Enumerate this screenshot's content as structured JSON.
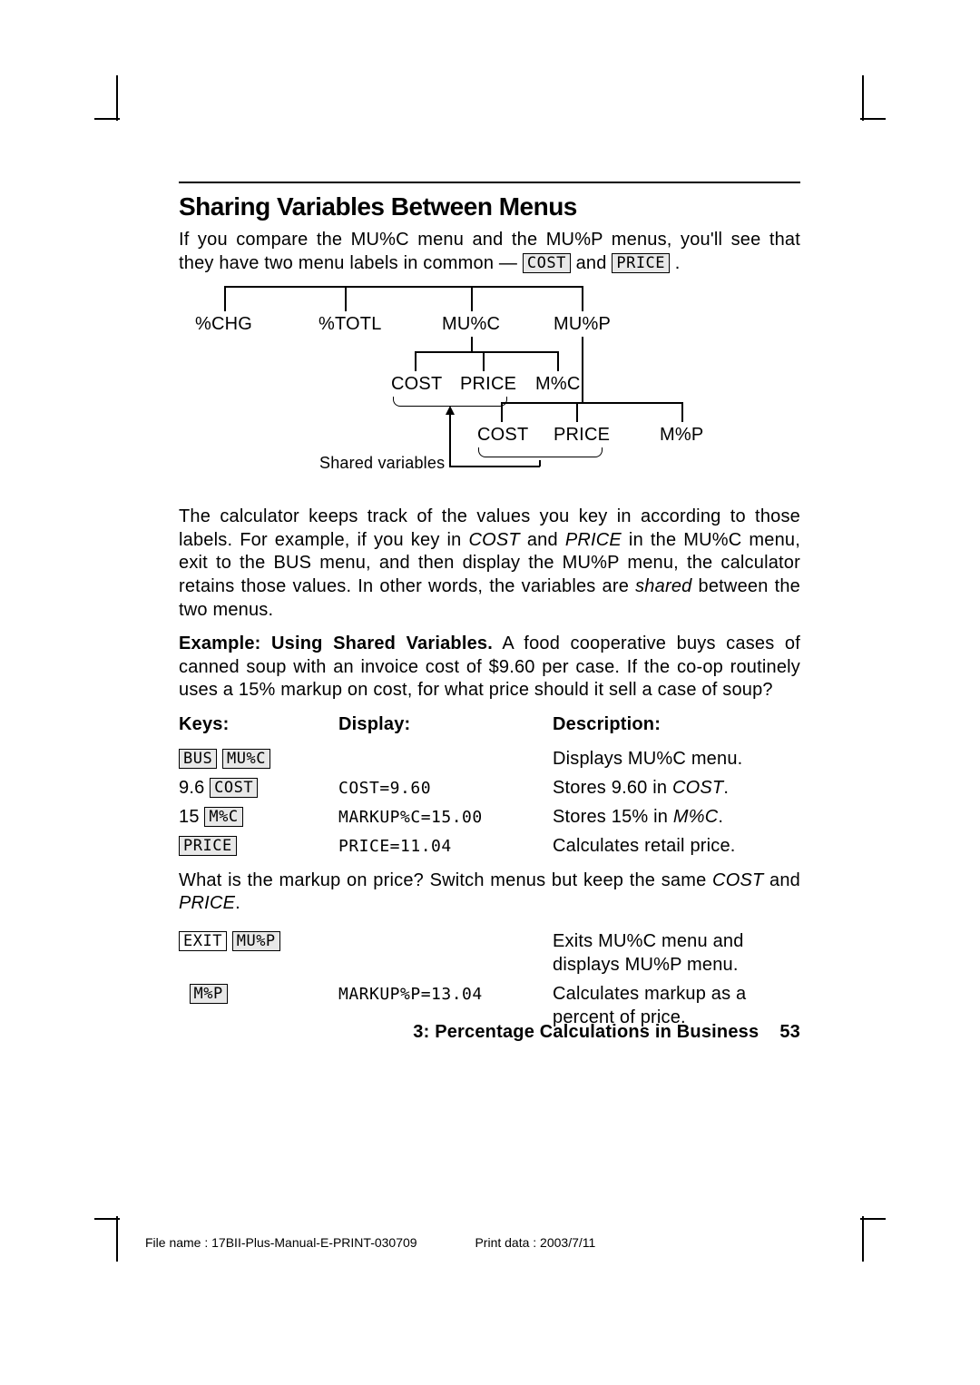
{
  "heading": "Sharing Variables Between Menus",
  "intro_1a": "If you compare the MU%C menu and the MU%P menus, you'll see that they have two menu labels in common — ",
  "key_cost": " COST ",
  "intro_1b": " and ",
  "key_price": "PRICE",
  "intro_1c": ".",
  "diagram": {
    "top": [
      "%CHG",
      "%TOTL",
      "MU%C",
      "MU%P"
    ],
    "mid": [
      "COST",
      "PRICE",
      "M%C"
    ],
    "bot": [
      "COST",
      "PRICE",
      "M%P"
    ],
    "shared_label": "Shared variables"
  },
  "para2_a": "The calculator keeps track of the values you key in according to those labels. For example, if you key in ",
  "para2_b": " and ",
  "para2_c": " in the MU%C menu, exit to the BUS menu, and then display the MU%P menu, the calculator retains those values. In other words, the variables are ",
  "para2_d": " between the two menus.",
  "ital_cost": "COST",
  "ital_price": "PRICE",
  "ital_shared": "shared",
  "example_lead": "Example: Using Shared Variables.",
  "example_body": " A food cooperative buys cases of canned soup with an invoice cost of $9.60 per case. If the co-op routinely uses a 15% markup on cost, for what price should it sell a case of soup?",
  "tbl_headers": [
    "Keys:",
    "Display:",
    "Description:"
  ],
  "rows1": [
    {
      "keys_pre": "",
      "key1": " BUS ",
      "key2": "MU%C",
      "keys_post": "",
      "display": "",
      "desc": "Displays MU%C menu."
    },
    {
      "keys_pre": "9.6 ",
      "key1": "COST",
      "key2": "",
      "keys_post": "",
      "display": "COST=9.60",
      "desc_a": "Stores 9.60 in ",
      "desc_i": "COST",
      "desc_b": "."
    },
    {
      "keys_pre": "15 ",
      "key1": " M%C ",
      "key2": "",
      "keys_post": "",
      "display": "MARKUP%C=15.00",
      "desc_a": "Stores 15% in ",
      "desc_i": "M%C",
      "desc_b": "."
    },
    {
      "keys_pre": "",
      "key1": "PRICE",
      "key2": "",
      "keys_post": "",
      "display": "PRICE=11.04",
      "desc": "Calculates retail price."
    }
  ],
  "mid_para_a": "What is the markup on price? Switch menus but keep the same ",
  "mid_para_b": " and ",
  "mid_para_c": ".",
  "rows2": [
    {
      "keys_pre": "",
      "key_hard": "EXIT",
      "key1": "MU%P",
      "display": "",
      "desc": "Exits MU%C menu and displays MU%P menu."
    },
    {
      "keys_pre": "",
      "key1": " M%P ",
      "display": "MARKUP%P=13.04",
      "desc": "Calculates markup as a percent of price."
    }
  ],
  "footer_chapter": "3: Percentage Calculations in Business",
  "footer_page": "53",
  "meta_file": "File name : 17BII-Plus-Manual-E-PRINT-030709",
  "meta_print": "Print data : 2003/7/11"
}
